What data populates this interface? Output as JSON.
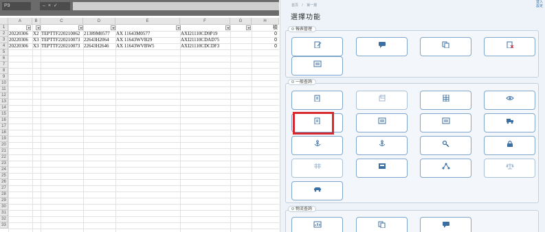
{
  "spreadsheet": {
    "name_box": "P9",
    "formula_bar_left": "–  ×  ✓",
    "columns": [
      "A",
      "B",
      "C",
      "D",
      "E",
      "F",
      "G",
      "H"
    ],
    "rows": [
      "1",
      "2",
      "3",
      "4",
      "5",
      "6",
      "7",
      "8",
      "9",
      "10",
      "11",
      "12",
      "13",
      "14",
      "15",
      "16",
      "17",
      "18",
      "19",
      "20",
      "21",
      "22",
      "23",
      "24",
      "25",
      "26",
      "27",
      "28",
      "29",
      "30",
      "31",
      "32",
      "33"
    ],
    "truncated_header": "檢",
    "data_rows": [
      {
        "a": "20220306",
        "b": "X2",
        "c": "TEPTTF220210062",
        "d": "21389M0577",
        "e": "AX  11643M0577",
        "f": "AXI21110CD9P19",
        "h": "0"
      },
      {
        "a": "20220306",
        "b": "X3",
        "c": "TEPTTF220210073",
        "d": "22643H2064",
        "e": "AX  11643WVB29",
        "f": "AXI21110CDAD75",
        "h": "0"
      },
      {
        "a": "20220306",
        "b": "X3",
        "c": "TEPTTF220210073",
        "d": "22643H2646",
        "e": "AX  11643WVBW5",
        "f": "AXI21110CDCDF3",
        "h": "0"
      }
    ]
  },
  "panel": {
    "breadcrumb": [
      "首頁",
      "第一層"
    ],
    "corner_link_1": "登入",
    "corner_link_2": "設定",
    "title": "選擇功能",
    "sections": [
      {
        "label": "報表管理"
      },
      {
        "label": "一般查詢"
      },
      {
        "label": "物流查詢"
      }
    ],
    "tiles_s1": [
      {
        "label": "",
        "icon": "edit-document-icon",
        "disabled": false
      },
      {
        "label": "",
        "icon": "chat-icon",
        "disabled": false
      },
      {
        "label": "",
        "icon": "copy-icon",
        "disabled": false
      },
      {
        "label": "",
        "icon": "delete-file-icon",
        "disabled": false
      },
      {
        "label": "",
        "icon": "list-icon",
        "disabled": false
      }
    ],
    "tiles_s2": [
      {
        "label": "",
        "icon": "document-icon",
        "disabled": false
      },
      {
        "label": "",
        "icon": "stack-icon",
        "disabled": true
      },
      {
        "label": "",
        "icon": "table-icon",
        "disabled": false
      },
      {
        "label": "",
        "icon": "eye-icon",
        "disabled": false
      },
      {
        "label": "",
        "icon": "document-icon",
        "disabled": false
      },
      {
        "label": "",
        "icon": "list-icon",
        "disabled": false
      },
      {
        "label": "",
        "icon": "list-icon",
        "disabled": false
      },
      {
        "label": "",
        "icon": "truck-icon",
        "disabled": false
      },
      {
        "label": "",
        "icon": "anchor-icon",
        "disabled": false
      },
      {
        "label": "",
        "icon": "anchor-icon",
        "disabled": false
      },
      {
        "label": "",
        "icon": "key-icon",
        "disabled": false
      },
      {
        "label": "",
        "icon": "lock-icon",
        "disabled": false
      },
      {
        "label": "",
        "icon": "grid-icon",
        "disabled": true
      },
      {
        "label": "",
        "icon": "inbox-icon",
        "disabled": false
      },
      {
        "label": "",
        "icon": "share-icon",
        "disabled": false
      },
      {
        "label": "",
        "icon": "scale-icon",
        "disabled": true
      },
      {
        "label": "",
        "icon": "car-icon",
        "disabled": false
      }
    ],
    "tiles_s3": [
      {
        "label": "",
        "icon": "chart-icon",
        "disabled": false
      },
      {
        "label": "",
        "icon": "copy-icon",
        "disabled": false
      },
      {
        "label": "",
        "icon": "chat-icon",
        "disabled": false
      }
    ],
    "colors": {
      "accent": "#7ea6cc",
      "highlight": "#d8282d",
      "panel_bg": "#edf3f8"
    }
  }
}
